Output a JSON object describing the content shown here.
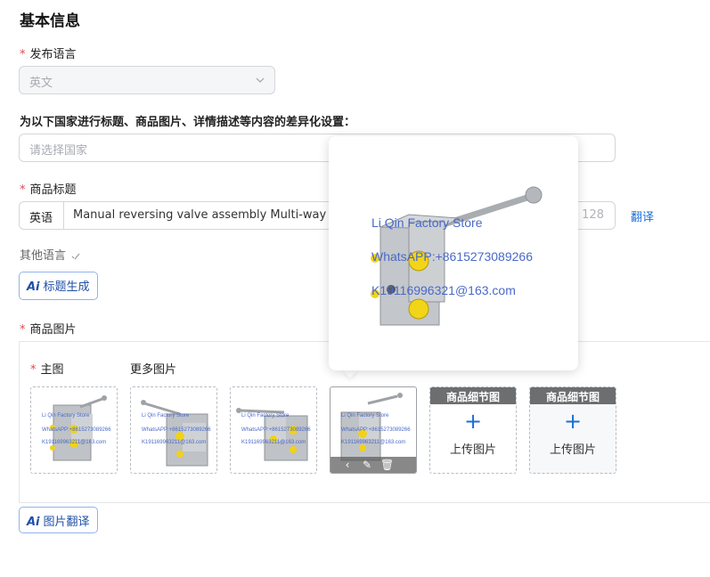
{
  "section_title": "基本信息",
  "publish_language": {
    "label": "发布语言",
    "value": "英文"
  },
  "country_setting": {
    "label": "为以下国家进行标题、商品图片、详情描述等内容的差异化设置：",
    "placeholder": "请选择国家"
  },
  "product_title": {
    "label": "商品标题",
    "lang_tag": "英语",
    "value": "Manual reversing valve assembly Multi-way thr",
    "count": "/ 128",
    "translate_link": "翻译"
  },
  "other_language": {
    "label": "其他语言"
  },
  "ai_title_button": {
    "ai_mark": "Ai",
    "label": "标题生成"
  },
  "product_images": {
    "label": "商品图片",
    "main_label": "主图",
    "more_label": "更多图片",
    "watermark": {
      "store": "Li Qin Factory Store",
      "whatsapp": "WhatsAPP:+8615273089266",
      "email": "K191169963211@163.com"
    },
    "upload_slots": [
      {
        "header": "商品细节图",
        "plus": "+",
        "text": "上传图片"
      },
      {
        "header": "商品细节图",
        "plus": "+",
        "text": "上传图片"
      }
    ]
  },
  "ai_translate_button": {
    "ai_mark": "Ai",
    "label": "图片翻译"
  },
  "popover": {
    "store": "Li Qin Factory Store",
    "whatsapp": "WhatsAPP:+8615273089266",
    "email": "K19116996321@163.com"
  },
  "colors": {
    "accent": "#1a6fd8",
    "required": "#e5484d",
    "ai_text": "#1f4fa8",
    "watermark": "#4a69c8",
    "upload_header": "#6d6e70"
  }
}
